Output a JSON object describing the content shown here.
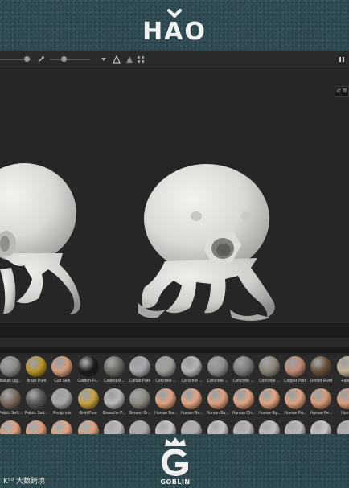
{
  "brand": {
    "name": "HAO"
  },
  "footer_brand": {
    "name": "GOBLIN"
  },
  "watermark": {
    "text": "K⁵⁰ 大数跨境"
  },
  "side_panel": {
    "tab_label": "对 图"
  },
  "materials": [
    {
      "row": 0,
      "label": "Basalt Lig...",
      "color": "#8c8a86"
    },
    {
      "row": 0,
      "label": "Brass Pure",
      "color": "#b89428"
    },
    {
      "row": 0,
      "label": "Calf Skin",
      "color": "#d79b7a"
    },
    {
      "row": 0,
      "label": "Carbon Fi...",
      "color": "#1c1c1c"
    },
    {
      "row": 0,
      "label": "Coated M...",
      "color": "#6a6a62"
    },
    {
      "row": 0,
      "label": "Cobalt Pure",
      "color": "#a7a9ad"
    },
    {
      "row": 0,
      "label": "Concrete ...",
      "color": "#9e9c97"
    },
    {
      "row": 0,
      "label": "Concrete ...",
      "color": "#b4b4b2"
    },
    {
      "row": 0,
      "label": "Concrete ...",
      "color": "#8e8e8c"
    },
    {
      "row": 0,
      "label": "Concrete ...",
      "color": "#7a7a78"
    },
    {
      "row": 0,
      "label": "Concrete ...",
      "color": "#8c8578"
    },
    {
      "row": 0,
      "label": "Copper Pure",
      "color": "#c08a70"
    },
    {
      "row": 0,
      "label": "Denim Rivet",
      "color": "#6a5038"
    },
    {
      "row": 0,
      "label": "Fabr...",
      "color": "#c3b395"
    },
    {
      "row": 1,
      "label": "Fabric Soft...",
      "color": "#7a6a5a"
    },
    {
      "row": 1,
      "label": "Fabric Suit...",
      "color": "#55575a"
    },
    {
      "row": 1,
      "label": "Footprints",
      "color": "#a8a8a6"
    },
    {
      "row": 1,
      "label": "Gold Pure",
      "color": "#c9a340"
    },
    {
      "row": 1,
      "label": "Gouache P...",
      "color": "#b8b8b4"
    },
    {
      "row": 1,
      "label": "Ground Gr...",
      "color": "#8d8a7e"
    },
    {
      "row": 1,
      "label": "Human Ba...",
      "color": "#e0a07e"
    },
    {
      "row": 1,
      "label": "Human Be...",
      "color": "#e4a582"
    },
    {
      "row": 1,
      "label": "Human Bu...",
      "color": "#dfa07d"
    },
    {
      "row": 1,
      "label": "Human Ch...",
      "color": "#e1a280"
    },
    {
      "row": 1,
      "label": "Human Ey...",
      "color": "#e3a380"
    },
    {
      "row": 1,
      "label": "Human Fa...",
      "color": "#e0a07c"
    },
    {
      "row": 1,
      "label": "Human Fe...",
      "color": "#d89a76"
    },
    {
      "row": 1,
      "label": "Hum...",
      "color": "#dc9d79"
    }
  ],
  "row3_colors": [
    "#e0a07e",
    "#dc9c7a",
    "#e2a280",
    "#dfa07d",
    "#bcbcbc",
    "#aaaaaa",
    "#c6c6c6",
    "#b0b0b0",
    "#c4c4c4",
    "#b6b6b6",
    "#c0c0c0",
    "#bababa",
    "#c8c8c8",
    "#b2b2b2"
  ]
}
